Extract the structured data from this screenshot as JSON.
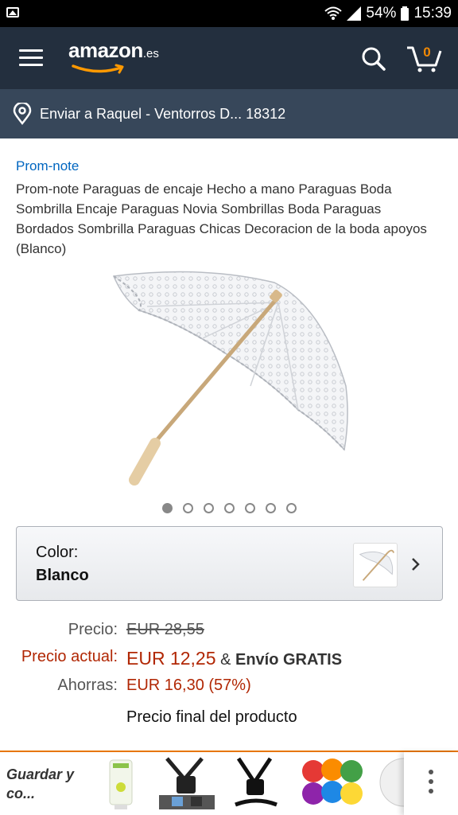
{
  "status_bar": {
    "battery_percent": "54%",
    "time": "15:39"
  },
  "header": {
    "logo_word": "amazon",
    "logo_tld": ".es",
    "cart_count": "0"
  },
  "address": {
    "text": "Enviar a Raquel - Ventorros D... 18312"
  },
  "product": {
    "brand": "Prom-note",
    "title": "Prom-note Paraguas de encaje Hecho a mano Paraguas Boda Sombrilla Encaje Paraguas Novia Sombrillas Boda Paraguas Bordados Sombrilla Paraguas Chicas Decoracion de la boda apoyos (Blanco)",
    "image_count": 7,
    "active_image_index": 0
  },
  "color_selector": {
    "label": "Color:",
    "value": "Blanco"
  },
  "pricing": {
    "list_price_label": "Precio:",
    "list_price": "EUR 28,55",
    "current_price_label": "Precio actual:",
    "current_price": "EUR 12,25",
    "shipping_sep": "&",
    "shipping": "Envío GRATIS",
    "savings_label": "Ahorras:",
    "savings": "EUR 16,30 (57%)",
    "final_note": "Precio final del producto"
  },
  "bottom_bar": {
    "saved_label": "Guardar y co..."
  },
  "colors": {
    "header_bg": "#232f3e",
    "address_bg": "#37475a",
    "link_blue": "#0066c0",
    "price_red": "#b12704",
    "accent_orange": "#e77600"
  }
}
